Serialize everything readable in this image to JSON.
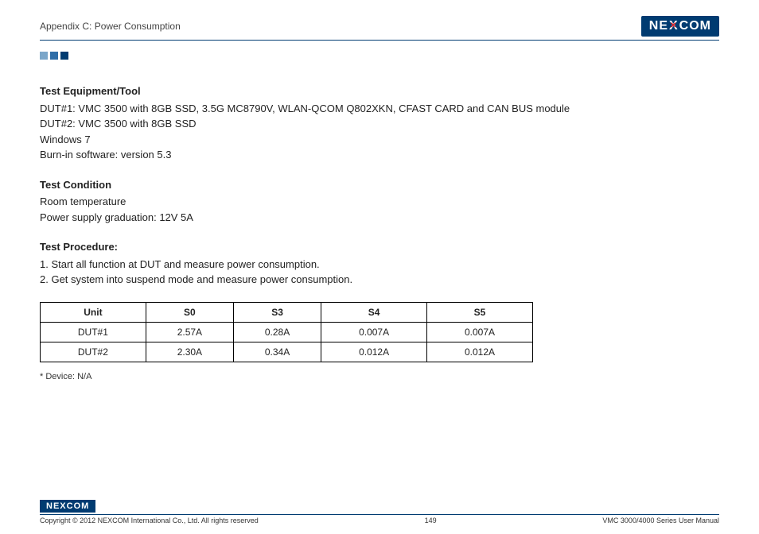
{
  "header": {
    "title": "Appendix C: Power Consumption",
    "logo_text_pre": "NE",
    "logo_text_mid": "X",
    "logo_text_post": "COM"
  },
  "sections": {
    "equipment": {
      "title": "Test Equipment/Tool",
      "lines": [
        "DUT#1: VMC 3500 with 8GB SSD, 3.5G MC8790V, WLAN-QCOM Q802XKN, CFAST CARD and CAN BUS module",
        "DUT#2: VMC 3500 with 8GB SSD",
        "Windows 7",
        "Burn-in software: version 5.3"
      ]
    },
    "condition": {
      "title": "Test Condition",
      "lines": [
        "Room temperature",
        "Power supply graduation: 12V 5A"
      ]
    },
    "procedure": {
      "title": "Test Procedure:",
      "lines": [
        "1. Start all function at DUT and measure power consumption.",
        "2. Get system into suspend mode and measure power consumption."
      ]
    }
  },
  "chart_data": {
    "type": "table",
    "title": "",
    "headers": [
      "Unit",
      "S0",
      "S3",
      "S4",
      "S5"
    ],
    "rows": [
      {
        "Unit": "DUT#1",
        "S0": "2.57A",
        "S3": "0.28A",
        "S4": "0.007A",
        "S5": "0.007A"
      },
      {
        "Unit": "DUT#2",
        "S0": "2.30A",
        "S3": "0.34A",
        "S4": "0.012A",
        "S5": "0.012A"
      }
    ],
    "footnote": "* Device: N/A"
  },
  "footer": {
    "logo_pre": "NE",
    "logo_mid": "X",
    "logo_post": "COM",
    "copyright": "Copyright © 2012 NEXCOM International Co., Ltd. All rights reserved",
    "page": "149",
    "manual": "VMC 3000/4000 Series User Manual"
  }
}
